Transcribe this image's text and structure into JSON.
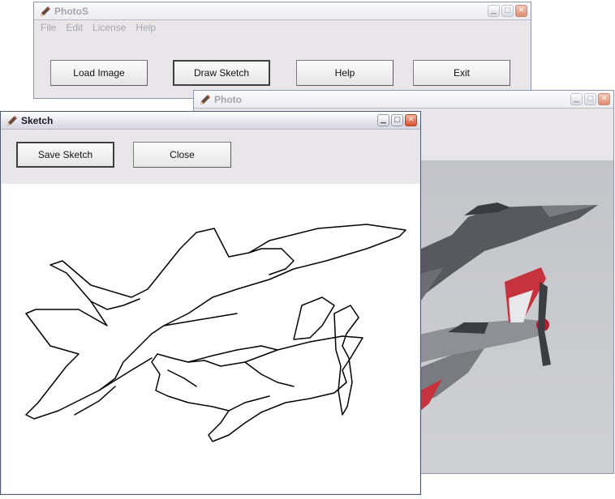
{
  "main_window": {
    "title": "PhotoS",
    "icon": "pencil-icon",
    "menu": [
      "File",
      "Edit",
      "License",
      "Help"
    ],
    "buttons": {
      "load_image": "Load Image",
      "draw_sketch": "Draw Sketch",
      "help": "Help",
      "exit": "Exit"
    }
  },
  "photo_window": {
    "title": "Photo",
    "icon": "pencil-icon"
  },
  "sketch_window": {
    "title": "Sketch",
    "icon": "pencil-icon",
    "buttons": {
      "save_sketch": "Save Sketch",
      "close": "Close"
    }
  },
  "window_controls": {
    "minimize": "minimize-icon",
    "maximize": "maximize-icon",
    "close": "close-icon"
  },
  "colors": {
    "window_face": "#e9e6e9",
    "close_button": "#d8512c"
  }
}
